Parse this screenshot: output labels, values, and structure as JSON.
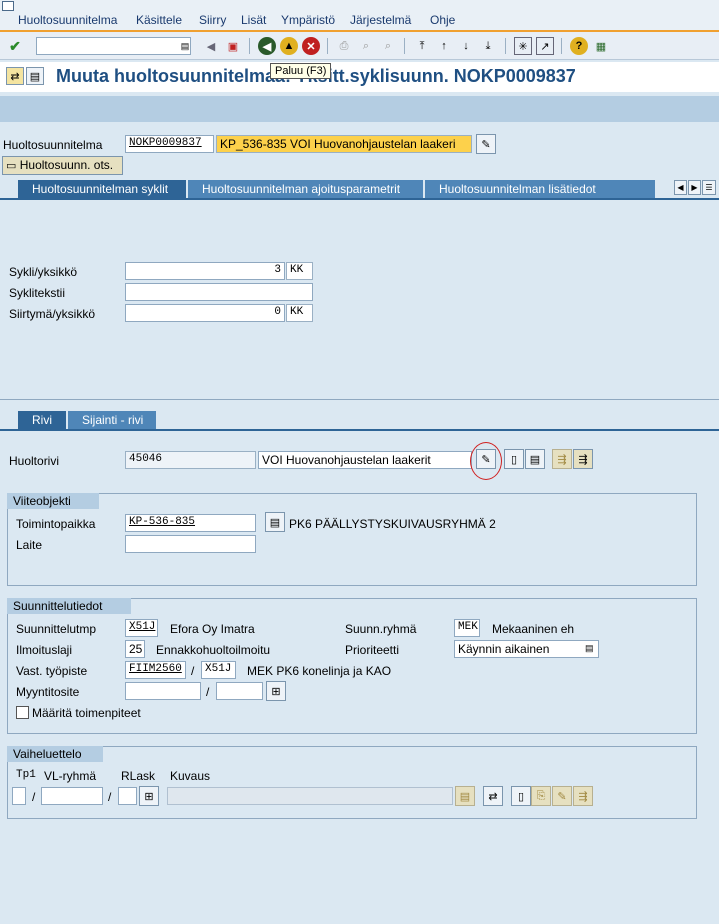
{
  "menubar": {
    "items": [
      "Huoltosuunnitelma",
      "Käsittele",
      "Siirry",
      "Lisät",
      "Ympäristö",
      "Järjestelmä",
      "Ohje"
    ]
  },
  "tooltip": "Paluu   (F3)",
  "title": "Muuta huoltosuunnitelmaa: Yksitt.syklisuunn. NOKP0009837",
  "header": {
    "plan_label": "Huoltosuunnitelma",
    "plan_value": "NOKP0009837",
    "plan_desc": "KP_536-835 VOI Huovanohjaustelan laakeri",
    "header_button": "Huoltosuunn. ots."
  },
  "tabs": [
    "Huoltosuunnitelman syklit",
    "Huoltosuunnitelman ajoitusparametrit",
    "Huoltosuunnitelman lisätiedot"
  ],
  "cycle": {
    "cycle_label": "Sykli/yksikkö",
    "cycle_value": "3",
    "cycle_unit": "KK",
    "text_label": "Syklitekstii",
    "offset_label": "Siirtymä/yksikkö",
    "offset_value": "0",
    "offset_unit": "KK"
  },
  "lower_tabs": [
    "Rivi",
    "Sijainti - rivi"
  ],
  "item": {
    "label": "Huoltorivi",
    "value": "45046",
    "desc": "VOI Huovanohjaustelan laakerit"
  },
  "refobj": {
    "title": "Viiteobjekti",
    "loc_label": "Toimintopaikka",
    "loc_value": "KP-536-835",
    "loc_desc": "PK6 PÄÄLLYSTYSKUIVAUSRYHMÄ 2",
    "equip_label": "Laite"
  },
  "planning": {
    "title": "Suunnittelutiedot",
    "plant_label": "Suunnittelutmp",
    "plant_value": "X51J",
    "plant_desc": "Efora Oy Imatra",
    "group_label": "Suunn.ryhmä",
    "group_value": "MEK",
    "group_desc": "Mekaaninen eh",
    "type_label": "Ilmoituslaji",
    "type_value": "25",
    "type_desc": "Ennakkohuoltoilmoitu",
    "prio_label": "Prioriteetti",
    "prio_value": "Käynnin aikainen",
    "wc_label": "Vast. työpiste",
    "wc_value": "FIIM2560",
    "wc_plant": "X51J",
    "wc_desc": "MEK PK6 konelinja ja KAO",
    "sales_label": "Myyntitosite",
    "check_label": "Määritä toimenpiteet"
  },
  "tasklist": {
    "title": "Vaiheluettelo",
    "col_type": "Tp1",
    "col_group": "VL-ryhmä",
    "col_counter": "RLask",
    "col_desc": "Kuvaus"
  },
  "colors": {
    "accent": "#f0a030",
    "title": "#1f4f82",
    "tab": "#4f86b8",
    "highlight": "#fdd14b"
  }
}
